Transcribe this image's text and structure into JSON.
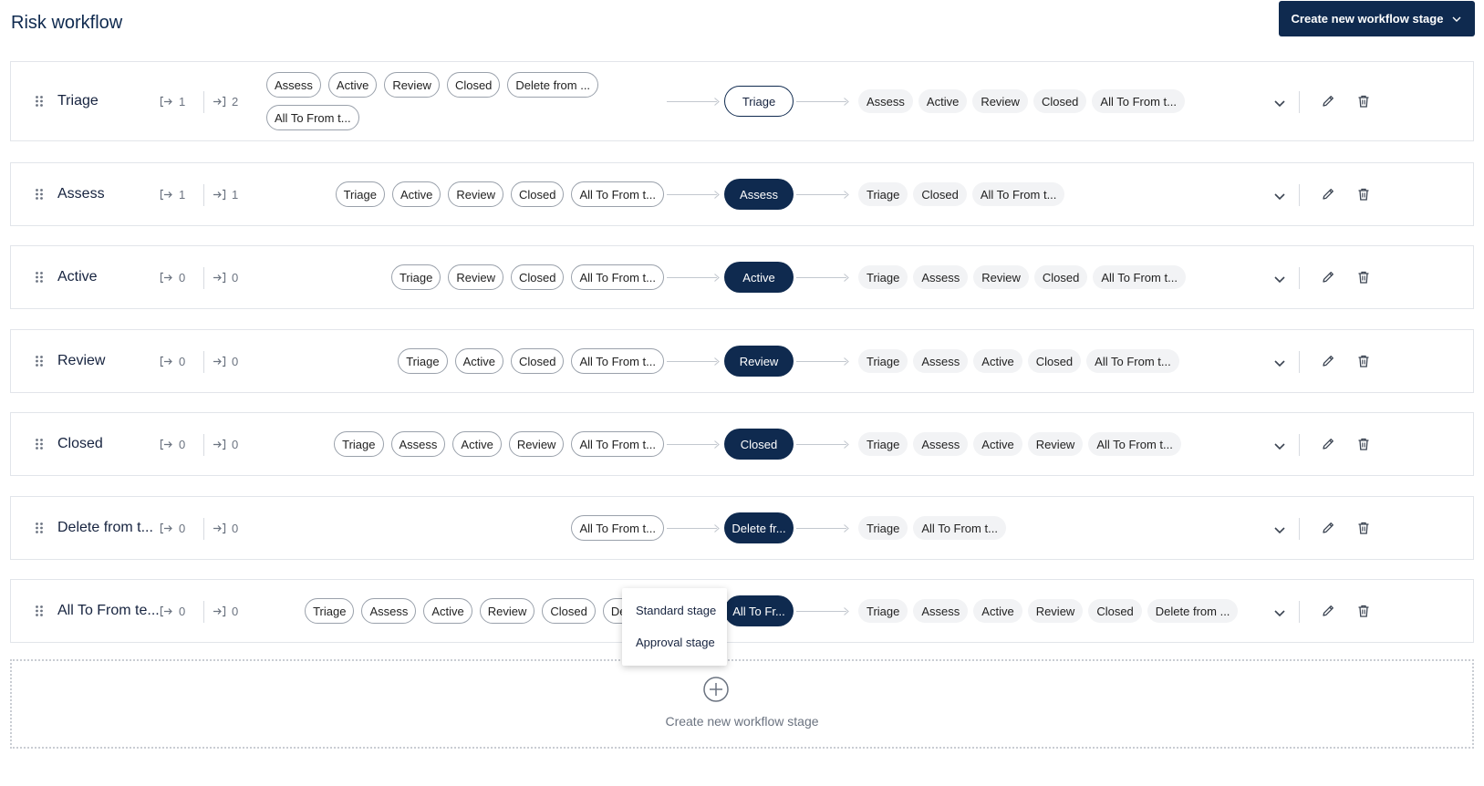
{
  "page": {
    "title": "Risk workflow",
    "create_button_label": "Create new workflow stage"
  },
  "colors": {
    "primary": "#0f2a4f",
    "chip_border": "#9aa1ab",
    "outgoing_chip_bg": "#f2f3f5",
    "muted_text": "#6b7380"
  },
  "stages": [
    {
      "name": "Triage",
      "incoming_count": "1",
      "outgoing_count": "2",
      "incoming": [
        "Assess",
        "Active",
        "Review",
        "Closed",
        "Delete from ...",
        "All To From t..."
      ],
      "pill_label": "Triage",
      "pill_style": "outlined",
      "outgoing": [
        "Assess",
        "Active",
        "Review",
        "Closed",
        "All To From t..."
      ]
    },
    {
      "name": "Assess",
      "incoming_count": "1",
      "outgoing_count": "1",
      "incoming": [
        "Triage",
        "Active",
        "Review",
        "Closed",
        "All To From t..."
      ],
      "pill_label": "Assess",
      "pill_style": "filled",
      "outgoing": [
        "Triage",
        "Closed",
        "All To From t..."
      ]
    },
    {
      "name": "Active",
      "incoming_count": "0",
      "outgoing_count": "0",
      "incoming": [
        "Triage",
        "Review",
        "Closed",
        "All To From t..."
      ],
      "pill_label": "Active",
      "pill_style": "filled",
      "outgoing": [
        "Triage",
        "Assess",
        "Review",
        "Closed",
        "All To From t..."
      ]
    },
    {
      "name": "Review",
      "incoming_count": "0",
      "outgoing_count": "0",
      "incoming": [
        "Triage",
        "Active",
        "Closed",
        "All To From t..."
      ],
      "pill_label": "Review",
      "pill_style": "filled",
      "outgoing": [
        "Triage",
        "Assess",
        "Active",
        "Closed",
        "All To From t..."
      ]
    },
    {
      "name": "Closed",
      "incoming_count": "0",
      "outgoing_count": "0",
      "incoming": [
        "Triage",
        "Assess",
        "Active",
        "Review",
        "All To From t..."
      ],
      "pill_label": "Closed",
      "pill_style": "filled",
      "outgoing": [
        "Triage",
        "Assess",
        "Active",
        "Review",
        "All To From t..."
      ]
    },
    {
      "name": "Delete from t...",
      "incoming_count": "0",
      "outgoing_count": "0",
      "incoming": [
        "All To From t..."
      ],
      "pill_label": "Delete fr...",
      "pill_style": "filled",
      "outgoing": [
        "Triage",
        "All To From t..."
      ]
    },
    {
      "name": "All To From te...",
      "incoming_count": "0",
      "outgoing_count": "0",
      "incoming": [
        "Triage",
        "Assess",
        "Active",
        "Review",
        "Closed",
        "Delete fr"
      ],
      "pill_label": "All To Fr...",
      "pill_style": "filled",
      "outgoing": [
        "Triage",
        "Assess",
        "Active",
        "Review",
        "Closed",
        "Delete from ..."
      ]
    }
  ],
  "dropdown_menu": {
    "items": [
      "Standard stage",
      "Approval stage"
    ]
  },
  "add_stage": {
    "label": "Create new workflow stage"
  },
  "icons": {
    "drag": "drag-handle-icon",
    "incoming": "incoming-arrow-icon",
    "outgoing": "outgoing-arrow-icon",
    "expand": "chevron-down-icon",
    "edit": "pencil-icon",
    "delete": "trash-icon",
    "add": "plus-circle-icon"
  }
}
